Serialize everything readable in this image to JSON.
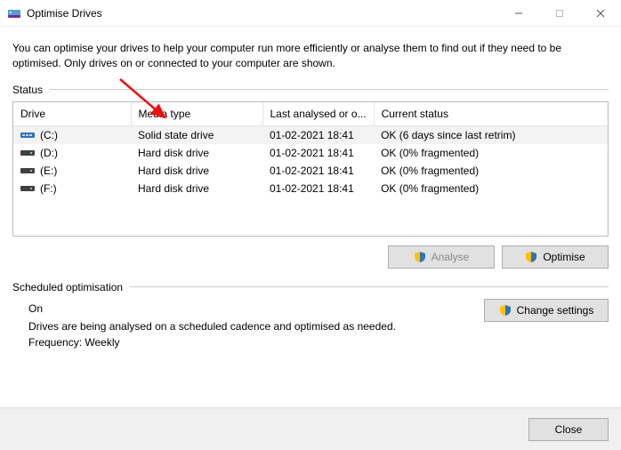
{
  "window": {
    "title": "Optimise Drives"
  },
  "intro": "You can optimise your drives to help your computer run more efficiently or analyse them to find out if they need to be optimised. Only drives on or connected to your computer are shown.",
  "status_label": "Status",
  "table": {
    "headers": {
      "drive": "Drive",
      "media": "Media type",
      "last": "Last analysed or o...",
      "status": "Current status"
    },
    "rows": [
      {
        "icon": "ssd",
        "drive": "(C:)",
        "media": "Solid state drive",
        "last": "01-02-2021 18:41",
        "status": "OK (6 days since last retrim)"
      },
      {
        "icon": "hdd",
        "drive": "(D:)",
        "media": "Hard disk drive",
        "last": "01-02-2021 18:41",
        "status": "OK (0% fragmented)"
      },
      {
        "icon": "hdd",
        "drive": "(E:)",
        "media": "Hard disk drive",
        "last": "01-02-2021 18:41",
        "status": "OK (0% fragmented)"
      },
      {
        "icon": "hdd",
        "drive": "(F:)",
        "media": "Hard disk drive",
        "last": "01-02-2021 18:41",
        "status": "OK (0% fragmented)"
      }
    ]
  },
  "buttons": {
    "analyse": "Analyse",
    "optimise": "Optimise",
    "change_settings": "Change settings",
    "close": "Close"
  },
  "scheduled": {
    "label": "Scheduled optimisation",
    "state": "On",
    "desc": "Drives are being analysed on a scheduled cadence and optimised as needed.",
    "freq": "Frequency: Weekly"
  }
}
